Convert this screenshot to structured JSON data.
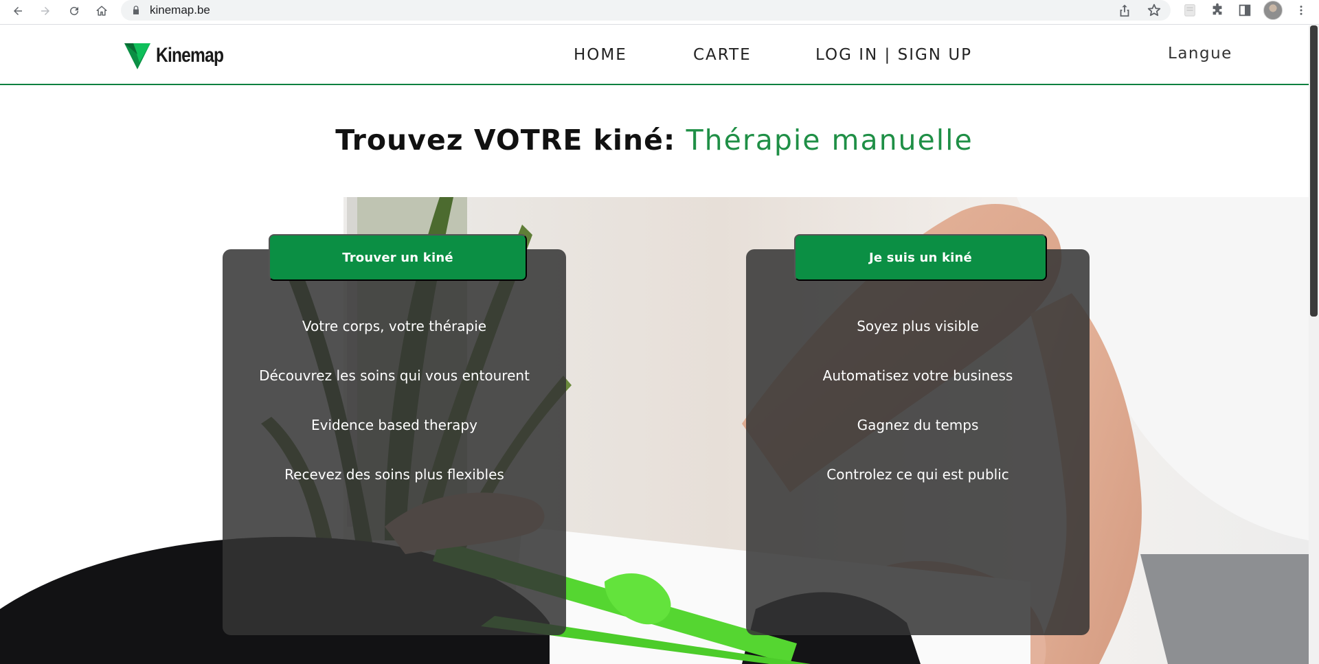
{
  "browser": {
    "url": "kinemap.be",
    "icons": [
      "back-icon",
      "forward-icon",
      "reload-icon",
      "home-icon",
      "lock-icon",
      "share-icon",
      "bookmark-star-icon",
      "extension-icon",
      "puzzle-icon",
      "side-panel-icon",
      "profile-avatar",
      "menu-kebab-icon"
    ]
  },
  "header": {
    "logo_text": "Kinemap",
    "nav": {
      "home": "HOME",
      "carte": "CARTE",
      "login": "LOG IN | SIGN UP"
    },
    "language": "Langue",
    "accent_color": "#0d8040"
  },
  "hero": {
    "title_prefix": "Trouvez VOTRE kiné:",
    "title_highlight": "Thérapie manuelle",
    "highlight_color": "#1f8f46"
  },
  "cards": {
    "patient": {
      "button": "Trouver un kiné",
      "items": [
        "Votre corps, votre thérapie",
        "Découvrez les soins qui vous entourent",
        "Evidence based therapy",
        "Recevez des soins plus flexibles"
      ]
    },
    "therapist": {
      "button": "Je suis un kiné",
      "items": [
        "Soyez plus visible",
        "Automatisez votre business",
        "Gagnez du temps",
        "Controlez ce qui est public"
      ]
    },
    "button_color": "#0b8f44"
  }
}
